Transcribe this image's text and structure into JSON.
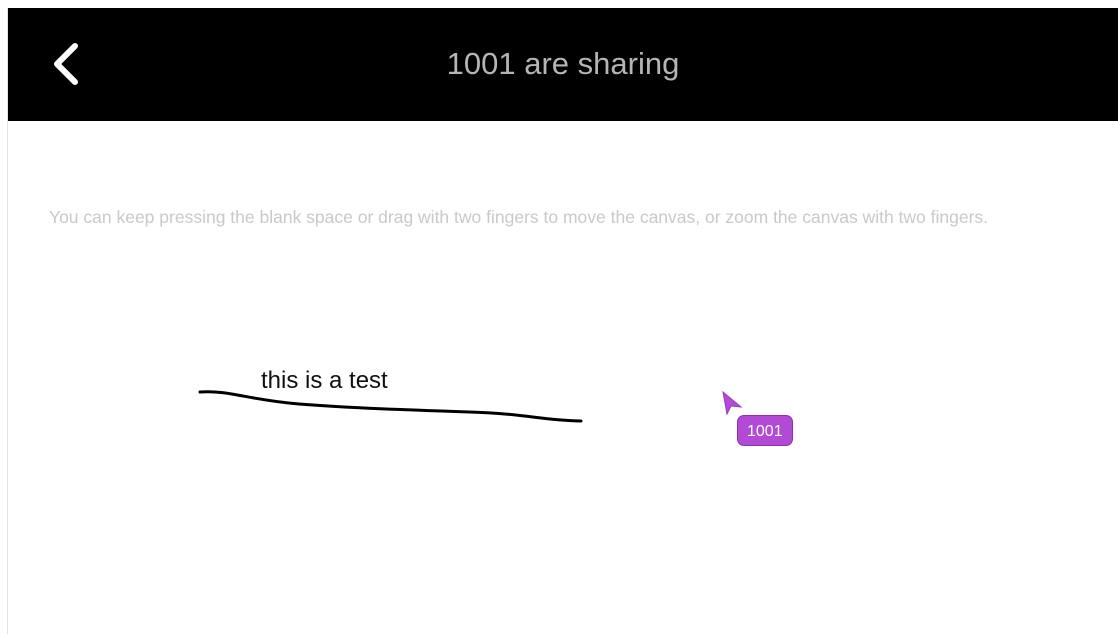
{
  "header": {
    "title": "1001 are sharing",
    "back_icon": "chevron-left-icon"
  },
  "canvas": {
    "hint": "You can keep pressing the blank space or drag with two fingers to move the canvas, or zoom the canvas with two fingers.",
    "annotation_text": "this is a test",
    "remote_cursor": {
      "label": "1001",
      "icon": "pointer-arrow-icon",
      "color": "#b34ad6"
    },
    "stroke_color": "#000000"
  },
  "colors": {
    "header_bg": "#000000",
    "title_text": "#b5b5b5",
    "hint_text": "#c9c9c9"
  }
}
